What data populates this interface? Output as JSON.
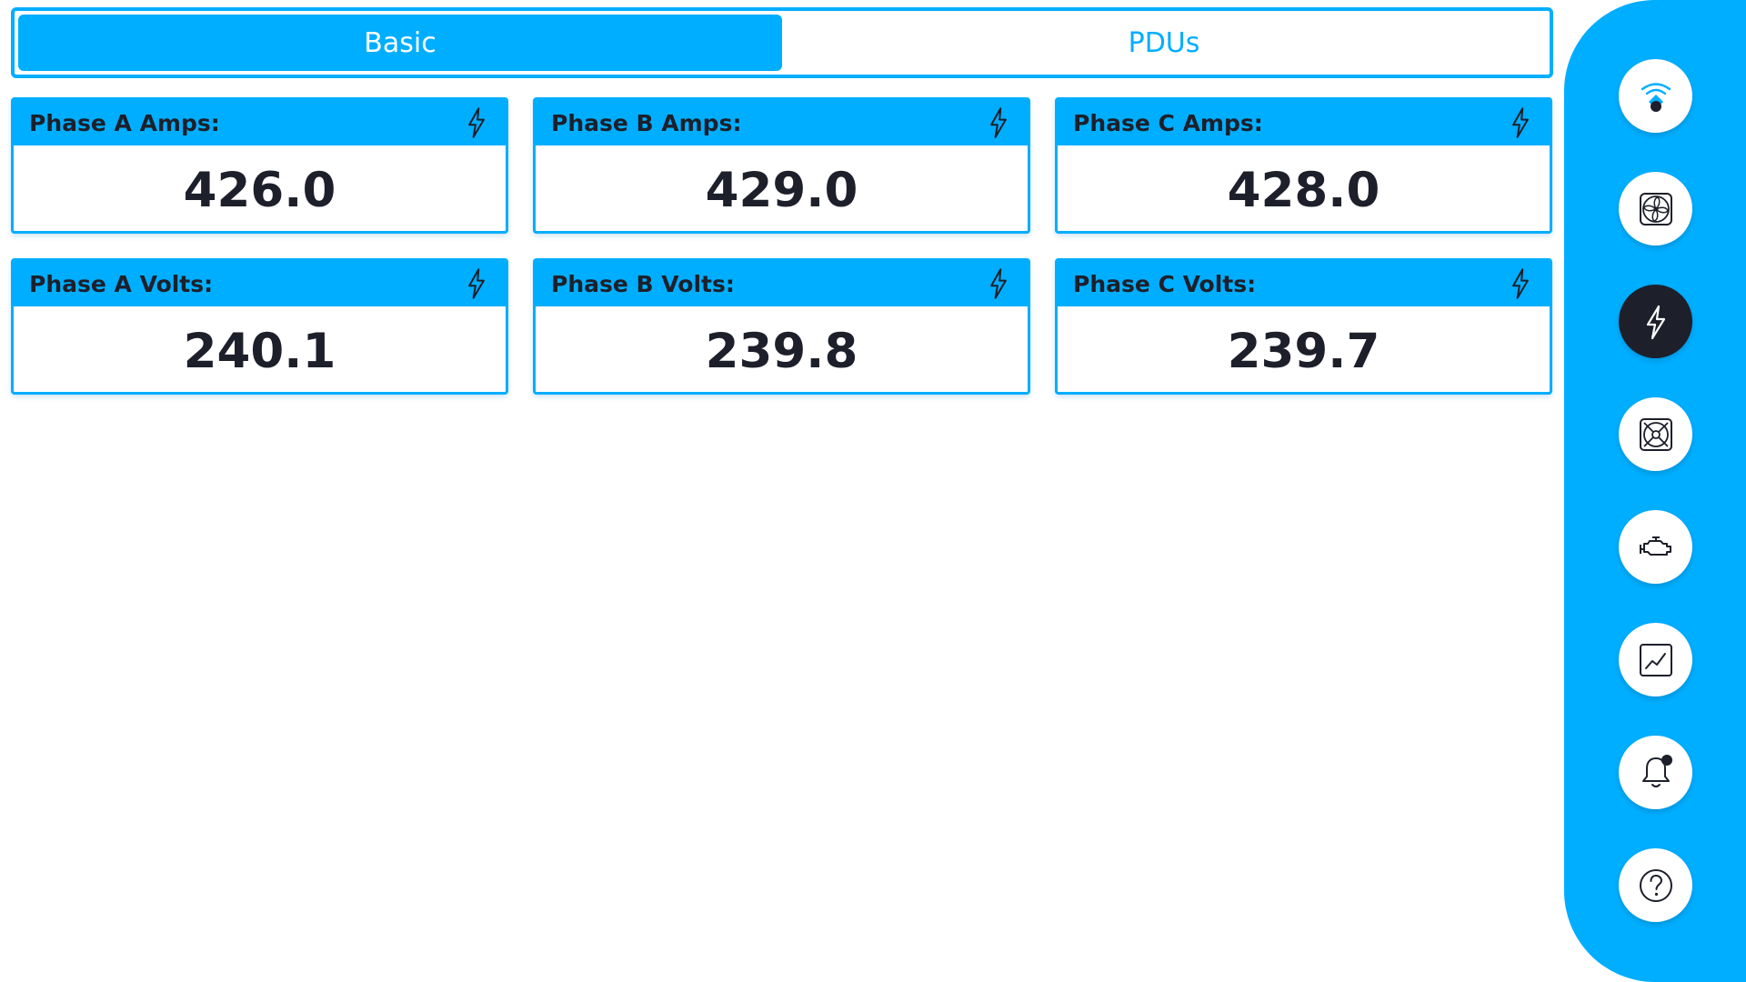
{
  "tabs": [
    {
      "label": "Basic",
      "active": true
    },
    {
      "label": "PDUs",
      "active": false
    }
  ],
  "cards": [
    {
      "title": "Phase A Amps:",
      "value": "426.0",
      "icon": "lightning-icon"
    },
    {
      "title": "Phase B Amps:",
      "value": "429.0",
      "icon": "lightning-icon"
    },
    {
      "title": "Phase C Amps:",
      "value": "428.0",
      "icon": "lightning-icon"
    },
    {
      "title": "Phase A Volts:",
      "value": "240.1",
      "icon": "lightning-icon"
    },
    {
      "title": "Phase B Volts:",
      "value": "239.8",
      "icon": "lightning-icon"
    },
    {
      "title": "Phase C Volts:",
      "value": "239.7",
      "icon": "lightning-icon"
    }
  ],
  "sidebar": {
    "items": [
      {
        "icon": "connection-status-icon",
        "active": false
      },
      {
        "icon": "fan-icon",
        "active": false
      },
      {
        "icon": "lightning-icon",
        "active": true
      },
      {
        "icon": "exhaust-fan-icon",
        "active": false
      },
      {
        "icon": "engine-icon",
        "active": false
      },
      {
        "icon": "chart-icon",
        "active": false
      },
      {
        "icon": "notification-bell-icon",
        "active": false
      },
      {
        "icon": "help-icon",
        "active": false
      }
    ]
  },
  "colors": {
    "accent": "#00aeff",
    "dark": "#1d1f2a",
    "white": "#ffffff"
  }
}
